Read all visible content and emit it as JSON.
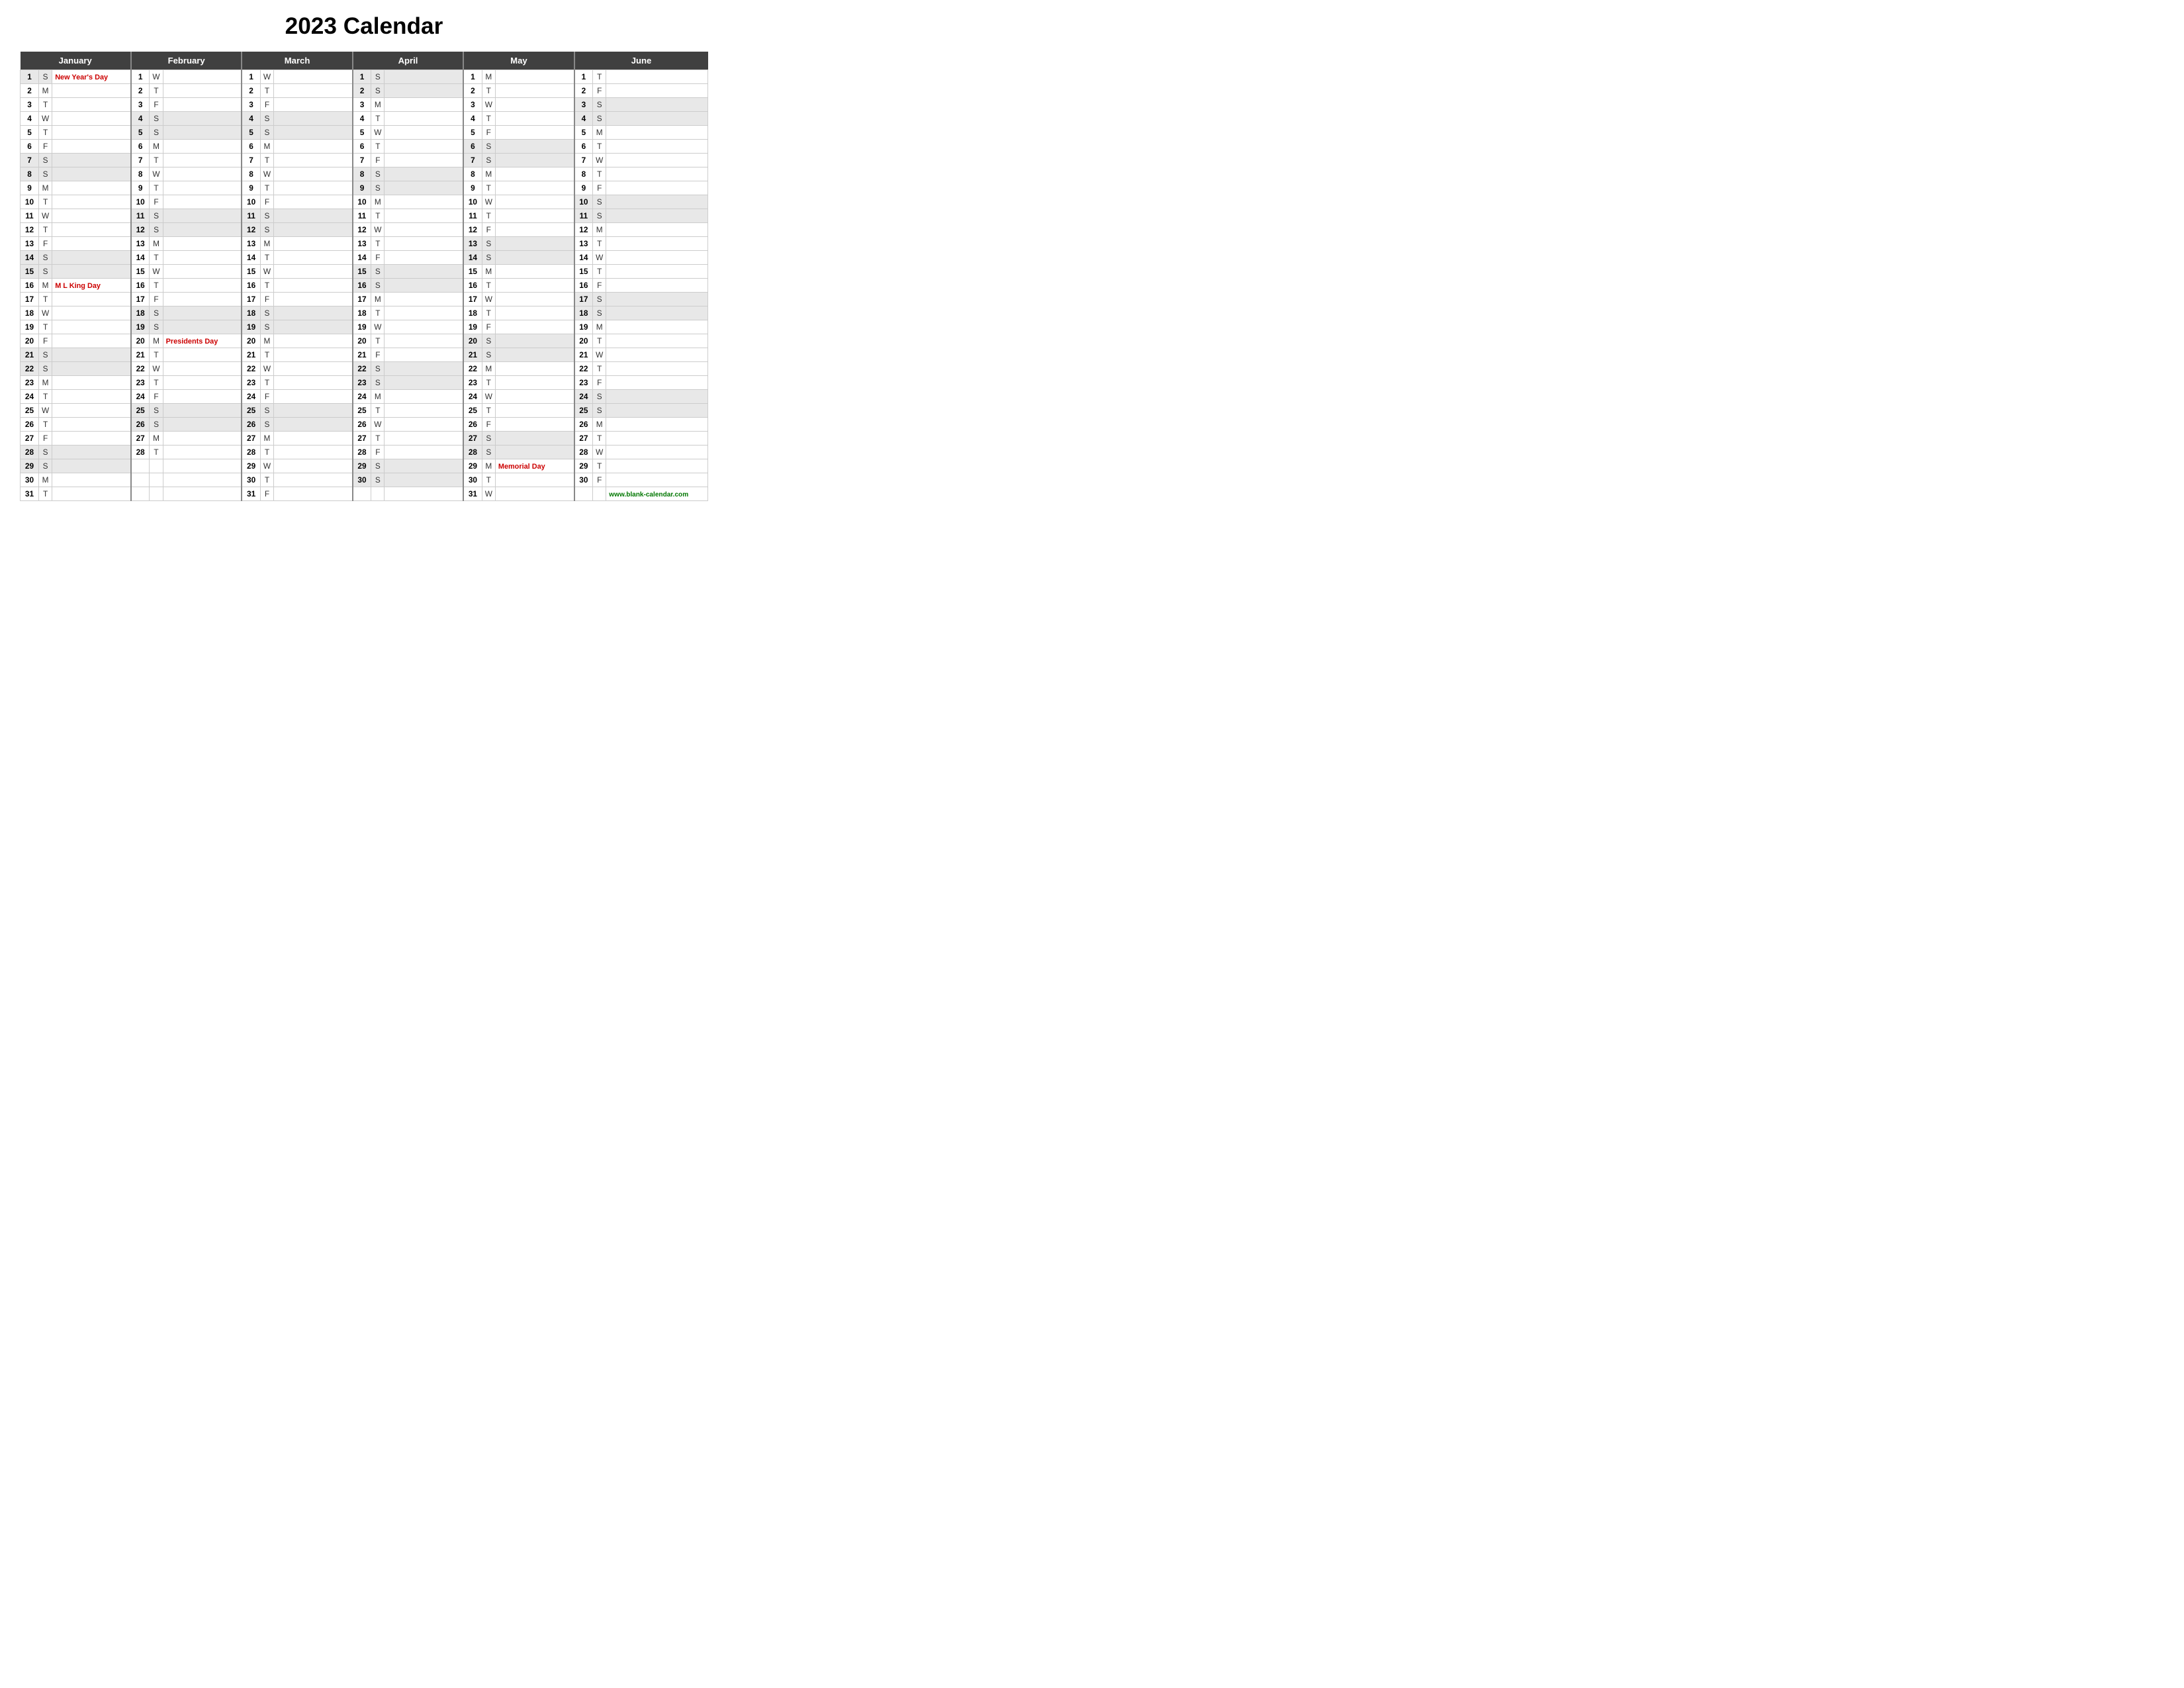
{
  "title": "2023 Calendar",
  "months": [
    "January",
    "February",
    "March",
    "April",
    "May",
    "June"
  ],
  "website": "www.blank-calendar.com",
  "holidays": {
    "jan_1": "New Year's Day",
    "jan_16": "M L King Day",
    "feb_20": "Presidents Day",
    "may_29": "Memorial Day"
  },
  "rows": [
    {
      "jan": {
        "d": 1,
        "w": "S",
        "h": "new-years"
      },
      "feb": {
        "d": 1,
        "w": "W"
      },
      "mar": {
        "d": 1,
        "w": "W"
      },
      "apr": {
        "d": 1,
        "w": "S"
      },
      "may": {
        "d": 1,
        "w": "M"
      },
      "jun": {
        "d": 1,
        "w": "T"
      }
    },
    {
      "jan": {
        "d": 2,
        "w": "M"
      },
      "feb": {
        "d": 2,
        "w": "T"
      },
      "mar": {
        "d": 2,
        "w": "T"
      },
      "apr": {
        "d": 2,
        "w": "S"
      },
      "may": {
        "d": 2,
        "w": "T"
      },
      "jun": {
        "d": 2,
        "w": "F"
      }
    },
    {
      "jan": {
        "d": 3,
        "w": "T"
      },
      "feb": {
        "d": 3,
        "w": "F"
      },
      "mar": {
        "d": 3,
        "w": "F"
      },
      "apr": {
        "d": 3,
        "w": "M"
      },
      "may": {
        "d": 3,
        "w": "W"
      },
      "jun": {
        "d": 3,
        "w": "S"
      }
    },
    {
      "jan": {
        "d": 4,
        "w": "W"
      },
      "feb": {
        "d": 4,
        "w": "S"
      },
      "mar": {
        "d": 4,
        "w": "S"
      },
      "apr": {
        "d": 4,
        "w": "T"
      },
      "may": {
        "d": 4,
        "w": "T"
      },
      "jun": {
        "d": 4,
        "w": "S"
      }
    },
    {
      "jan": {
        "d": 5,
        "w": "T"
      },
      "feb": {
        "d": 5,
        "w": "S"
      },
      "mar": {
        "d": 5,
        "w": "S"
      },
      "apr": {
        "d": 5,
        "w": "W"
      },
      "may": {
        "d": 5,
        "w": "F"
      },
      "jun": {
        "d": 5,
        "w": "M"
      }
    },
    {
      "jan": {
        "d": 6,
        "w": "F"
      },
      "feb": {
        "d": 6,
        "w": "M"
      },
      "mar": {
        "d": 6,
        "w": "M"
      },
      "apr": {
        "d": 6,
        "w": "T"
      },
      "may": {
        "d": 6,
        "w": "S"
      },
      "jun": {
        "d": 6,
        "w": "T"
      }
    },
    {
      "jan": {
        "d": 7,
        "w": "S"
      },
      "feb": {
        "d": 7,
        "w": "T"
      },
      "mar": {
        "d": 7,
        "w": "T"
      },
      "apr": {
        "d": 7,
        "w": "F"
      },
      "may": {
        "d": 7,
        "w": "S"
      },
      "jun": {
        "d": 7,
        "w": "W"
      }
    },
    {
      "jan": {
        "d": 8,
        "w": "S"
      },
      "feb": {
        "d": 8,
        "w": "W"
      },
      "mar": {
        "d": 8,
        "w": "W"
      },
      "apr": {
        "d": 8,
        "w": "S"
      },
      "may": {
        "d": 8,
        "w": "M"
      },
      "jun": {
        "d": 8,
        "w": "T"
      }
    },
    {
      "jan": {
        "d": 9,
        "w": "M"
      },
      "feb": {
        "d": 9,
        "w": "T"
      },
      "mar": {
        "d": 9,
        "w": "T"
      },
      "apr": {
        "d": 9,
        "w": "S"
      },
      "may": {
        "d": 9,
        "w": "T"
      },
      "jun": {
        "d": 9,
        "w": "F"
      }
    },
    {
      "jan": {
        "d": 10,
        "w": "T"
      },
      "feb": {
        "d": 10,
        "w": "F"
      },
      "mar": {
        "d": 10,
        "w": "F"
      },
      "apr": {
        "d": 10,
        "w": "M"
      },
      "may": {
        "d": 10,
        "w": "W"
      },
      "jun": {
        "d": 10,
        "w": "S"
      }
    },
    {
      "jan": {
        "d": 11,
        "w": "W"
      },
      "feb": {
        "d": 11,
        "w": "S"
      },
      "mar": {
        "d": 11,
        "w": "S"
      },
      "apr": {
        "d": 11,
        "w": "T"
      },
      "may": {
        "d": 11,
        "w": "T"
      },
      "jun": {
        "d": 11,
        "w": "S"
      }
    },
    {
      "jan": {
        "d": 12,
        "w": "T"
      },
      "feb": {
        "d": 12,
        "w": "S"
      },
      "mar": {
        "d": 12,
        "w": "S"
      },
      "apr": {
        "d": 12,
        "w": "W"
      },
      "may": {
        "d": 12,
        "w": "F"
      },
      "jun": {
        "d": 12,
        "w": "M"
      }
    },
    {
      "jan": {
        "d": 13,
        "w": "F"
      },
      "feb": {
        "d": 13,
        "w": "M"
      },
      "mar": {
        "d": 13,
        "w": "M"
      },
      "apr": {
        "d": 13,
        "w": "T"
      },
      "may": {
        "d": 13,
        "w": "S"
      },
      "jun": {
        "d": 13,
        "w": "T"
      }
    },
    {
      "jan": {
        "d": 14,
        "w": "S"
      },
      "feb": {
        "d": 14,
        "w": "T"
      },
      "mar": {
        "d": 14,
        "w": "T"
      },
      "apr": {
        "d": 14,
        "w": "F"
      },
      "may": {
        "d": 14,
        "w": "S"
      },
      "jun": {
        "d": 14,
        "w": "W"
      }
    },
    {
      "jan": {
        "d": 15,
        "w": "S"
      },
      "feb": {
        "d": 15,
        "w": "W"
      },
      "mar": {
        "d": 15,
        "w": "W"
      },
      "apr": {
        "d": 15,
        "w": "S"
      },
      "may": {
        "d": 15,
        "w": "M"
      },
      "jun": {
        "d": 15,
        "w": "T"
      }
    },
    {
      "jan": {
        "d": 16,
        "w": "M",
        "h": "mlk"
      },
      "feb": {
        "d": 16,
        "w": "T"
      },
      "mar": {
        "d": 16,
        "w": "T"
      },
      "apr": {
        "d": 16,
        "w": "S"
      },
      "may": {
        "d": 16,
        "w": "T"
      },
      "jun": {
        "d": 16,
        "w": "F"
      }
    },
    {
      "jan": {
        "d": 17,
        "w": "T"
      },
      "feb": {
        "d": 17,
        "w": "F"
      },
      "mar": {
        "d": 17,
        "w": "F"
      },
      "apr": {
        "d": 17,
        "w": "M"
      },
      "may": {
        "d": 17,
        "w": "W"
      },
      "jun": {
        "d": 17,
        "w": "S"
      }
    },
    {
      "jan": {
        "d": 18,
        "w": "W"
      },
      "feb": {
        "d": 18,
        "w": "S"
      },
      "mar": {
        "d": 18,
        "w": "S"
      },
      "apr": {
        "d": 18,
        "w": "T"
      },
      "may": {
        "d": 18,
        "w": "T"
      },
      "jun": {
        "d": 18,
        "w": "S"
      }
    },
    {
      "jan": {
        "d": 19,
        "w": "T"
      },
      "feb": {
        "d": 19,
        "w": "S"
      },
      "mar": {
        "d": 19,
        "w": "S"
      },
      "apr": {
        "d": 19,
        "w": "W"
      },
      "may": {
        "d": 19,
        "w": "F"
      },
      "jun": {
        "d": 19,
        "w": "M"
      }
    },
    {
      "jan": {
        "d": 20,
        "w": "F"
      },
      "feb": {
        "d": 20,
        "w": "M",
        "h": "presidents"
      },
      "mar": {
        "d": 20,
        "w": "M"
      },
      "apr": {
        "d": 20,
        "w": "T"
      },
      "may": {
        "d": 20,
        "w": "S"
      },
      "jun": {
        "d": 20,
        "w": "T"
      }
    },
    {
      "jan": {
        "d": 21,
        "w": "S"
      },
      "feb": {
        "d": 21,
        "w": "T"
      },
      "mar": {
        "d": 21,
        "w": "T"
      },
      "apr": {
        "d": 21,
        "w": "F"
      },
      "may": {
        "d": 21,
        "w": "S"
      },
      "jun": {
        "d": 21,
        "w": "W"
      }
    },
    {
      "jan": {
        "d": 22,
        "w": "S"
      },
      "feb": {
        "d": 22,
        "w": "W"
      },
      "mar": {
        "d": 22,
        "w": "W"
      },
      "apr": {
        "d": 22,
        "w": "S"
      },
      "may": {
        "d": 22,
        "w": "M"
      },
      "jun": {
        "d": 22,
        "w": "T"
      }
    },
    {
      "jan": {
        "d": 23,
        "w": "M"
      },
      "feb": {
        "d": 23,
        "w": "T"
      },
      "mar": {
        "d": 23,
        "w": "T"
      },
      "apr": {
        "d": 23,
        "w": "S"
      },
      "may": {
        "d": 23,
        "w": "T"
      },
      "jun": {
        "d": 23,
        "w": "F"
      }
    },
    {
      "jan": {
        "d": 24,
        "w": "T"
      },
      "feb": {
        "d": 24,
        "w": "F"
      },
      "mar": {
        "d": 24,
        "w": "F"
      },
      "apr": {
        "d": 24,
        "w": "M"
      },
      "may": {
        "d": 24,
        "w": "W"
      },
      "jun": {
        "d": 24,
        "w": "S"
      }
    },
    {
      "jan": {
        "d": 25,
        "w": "W"
      },
      "feb": {
        "d": 25,
        "w": "S"
      },
      "mar": {
        "d": 25,
        "w": "S"
      },
      "apr": {
        "d": 25,
        "w": "T"
      },
      "may": {
        "d": 25,
        "w": "T"
      },
      "jun": {
        "d": 25,
        "w": "S"
      }
    },
    {
      "jan": {
        "d": 26,
        "w": "T"
      },
      "feb": {
        "d": 26,
        "w": "S"
      },
      "mar": {
        "d": 26,
        "w": "S"
      },
      "apr": {
        "d": 26,
        "w": "W"
      },
      "may": {
        "d": 26,
        "w": "F"
      },
      "jun": {
        "d": 26,
        "w": "M"
      }
    },
    {
      "jan": {
        "d": 27,
        "w": "F"
      },
      "feb": {
        "d": 27,
        "w": "M"
      },
      "mar": {
        "d": 27,
        "w": "M"
      },
      "apr": {
        "d": 27,
        "w": "T"
      },
      "may": {
        "d": 27,
        "w": "S"
      },
      "jun": {
        "d": 27,
        "w": "T"
      }
    },
    {
      "jan": {
        "d": 28,
        "w": "S"
      },
      "feb": {
        "d": 28,
        "w": "T"
      },
      "mar": {
        "d": 28,
        "w": "T"
      },
      "apr": {
        "d": 28,
        "w": "F"
      },
      "may": {
        "d": 28,
        "w": "S"
      },
      "jun": {
        "d": 28,
        "w": "W"
      }
    },
    {
      "jan": {
        "d": 29,
        "w": "S"
      },
      "feb": null,
      "mar": {
        "d": 29,
        "w": "W"
      },
      "apr": {
        "d": 29,
        "w": "S"
      },
      "may": {
        "d": 29,
        "w": "M",
        "h": "memorial"
      },
      "jun": {
        "d": 29,
        "w": "T"
      }
    },
    {
      "jan": {
        "d": 30,
        "w": "M"
      },
      "feb": null,
      "mar": {
        "d": 30,
        "w": "T"
      },
      "apr": {
        "d": 30,
        "w": "S"
      },
      "may": {
        "d": 30,
        "w": "T"
      },
      "jun": {
        "d": 30,
        "w": "F"
      }
    },
    {
      "jan": {
        "d": 31,
        "w": "T"
      },
      "feb": null,
      "mar": {
        "d": 31,
        "w": "F"
      },
      "apr": null,
      "may": {
        "d": 31,
        "w": "W"
      },
      "jun": null
    }
  ]
}
